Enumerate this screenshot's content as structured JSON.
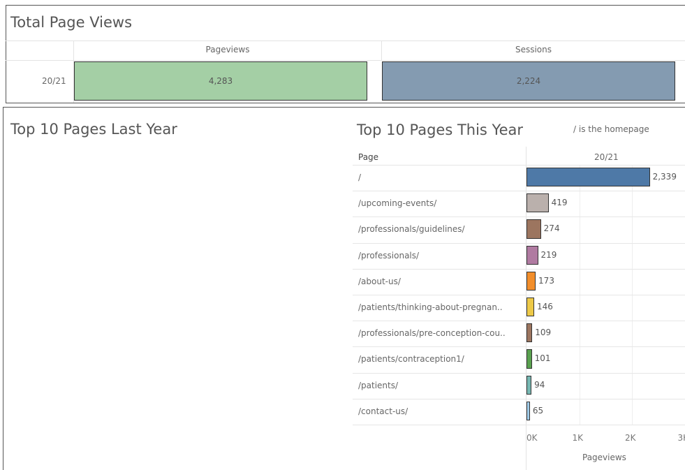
{
  "kpi": {
    "title": "Total Page Views",
    "columns": [
      "Pageviews",
      "Sessions"
    ],
    "row_label": "20/21",
    "values": [
      "4,283",
      "2,224"
    ],
    "colors": [
      "#a4cfa5",
      "#849bb1"
    ]
  },
  "last_year": {
    "title": "Top 10 Pages Last Year"
  },
  "this_year": {
    "title": "Top 10 Pages This Year",
    "note": "/ is the homepage",
    "column_header_page": "Page",
    "column_header_period": "20/21",
    "x_axis_label": "Pageviews",
    "x_ticks": [
      "0K",
      "1K",
      "2K",
      "3K"
    ]
  },
  "chart_data": [
    {
      "type": "bar",
      "title": "Total Page Views",
      "categories": [
        "Pageviews",
        "Sessions"
      ],
      "values": [
        4283,
        2224
      ],
      "row_label": "20/21"
    },
    {
      "type": "bar",
      "orientation": "horizontal",
      "title": "Top 10 Pages This Year",
      "xlabel": "Pageviews",
      "xlim": [
        0,
        3000
      ],
      "grid": true,
      "categories": [
        "/",
        "/upcoming-events/",
        "/professionals/guidelines/",
        "/professionals/",
        "/about-us/",
        "/patients/thinking-about-pregnan..",
        "/professionals/pre-conception-cou..",
        "/patients/contraception1/",
        "/patients/",
        "/contact-us/"
      ],
      "values": [
        2339,
        419,
        274,
        219,
        173,
        146,
        109,
        101,
        94,
        65
      ],
      "value_labels": [
        "2,339",
        "419",
        "274",
        "219",
        "173",
        "146",
        "109",
        "101",
        "94",
        "65"
      ],
      "colors": [
        "#4e79a7",
        "#bab0ac",
        "#9c755f",
        "#b07aa1",
        "#f28e2b",
        "#edc948",
        "#9c755f",
        "#59a14f",
        "#76b7b2",
        "#a0cbe8"
      ]
    }
  ]
}
